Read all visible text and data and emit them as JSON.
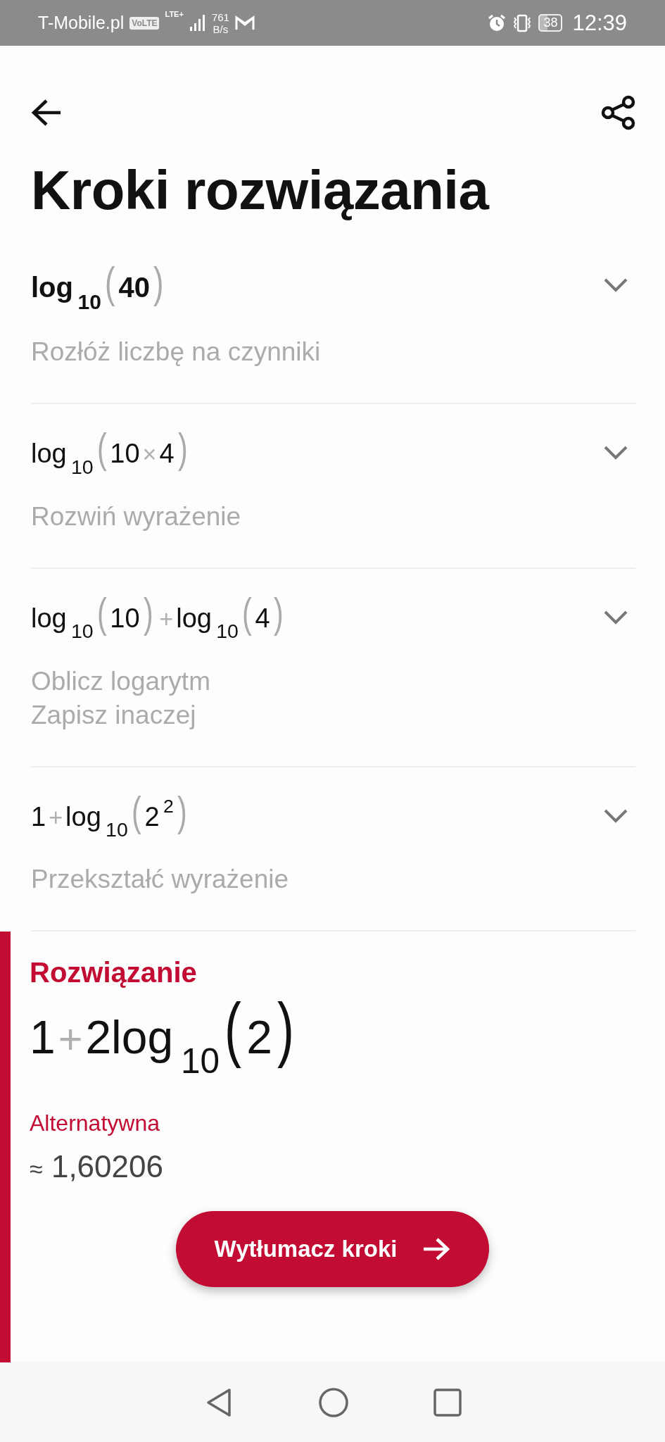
{
  "status_bar": {
    "carrier": "T-Mobile.pl",
    "volte": "VoLTE",
    "network": "LTE+",
    "speed": "761",
    "speed_unit": "B/s",
    "battery": "38",
    "time": "12:39"
  },
  "title": "Kroki rozwiązania",
  "steps": [
    {
      "highlighted": true,
      "expanded": false,
      "expression": [
        {
          "kind": "fn",
          "text": "log",
          "sub": "10"
        },
        {
          "kind": "paren",
          "text": "("
        },
        {
          "kind": "num",
          "text": "40"
        },
        {
          "kind": "paren",
          "text": ")"
        }
      ],
      "description": [
        "Rozłóż liczbę na czynniki"
      ]
    },
    {
      "highlighted": false,
      "expanded": false,
      "expression": [
        {
          "kind": "fn",
          "text": "log",
          "sub": "10"
        },
        {
          "kind": "paren",
          "text": "("
        },
        {
          "kind": "num",
          "text": "10"
        },
        {
          "kind": "op",
          "text": "×"
        },
        {
          "kind": "num",
          "text": "4"
        },
        {
          "kind": "paren",
          "text": ")"
        }
      ],
      "description": [
        "Rozwiń wyrażenie"
      ]
    },
    {
      "highlighted": false,
      "expanded": false,
      "expression": [
        {
          "kind": "fn",
          "text": "log",
          "sub": "10"
        },
        {
          "kind": "paren",
          "text": "("
        },
        {
          "kind": "num",
          "text": "10"
        },
        {
          "kind": "paren",
          "text": ")"
        },
        {
          "kind": "op",
          "text": "+"
        },
        {
          "kind": "fn",
          "text": "log",
          "sub": "10"
        },
        {
          "kind": "paren",
          "text": "("
        },
        {
          "kind": "num",
          "text": "4"
        },
        {
          "kind": "paren",
          "text": ")"
        }
      ],
      "description": [
        "Oblicz logarytm",
        "Zapisz inaczej"
      ]
    },
    {
      "highlighted": false,
      "expanded": false,
      "expression": [
        {
          "kind": "num",
          "text": "1"
        },
        {
          "kind": "op",
          "text": "+"
        },
        {
          "kind": "fn",
          "text": "log",
          "sub": "10"
        },
        {
          "kind": "paren",
          "text": "("
        },
        {
          "kind": "num",
          "text": "2",
          "sup": "2"
        },
        {
          "kind": "paren",
          "text": ")"
        }
      ],
      "description": [
        "Przekształć wyrażenie"
      ]
    }
  ],
  "solution": {
    "label": "Rozwiązanie",
    "expression": [
      {
        "kind": "num",
        "text": "1"
      },
      {
        "kind": "op",
        "text": "+"
      },
      {
        "kind": "fn",
        "text": "2log",
        "sub": "10"
      },
      {
        "kind": "paren",
        "text": "("
      },
      {
        "kind": "num",
        "text": "2"
      },
      {
        "kind": "paren",
        "text": ")"
      }
    ],
    "alternative_label": "Alternatywna",
    "approx": "≈",
    "approx_value": "1,60206"
  },
  "explain_button": "Wytłumacz kroki"
}
